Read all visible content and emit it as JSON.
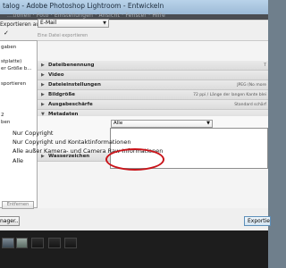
{
  "window": {
    "title": "talog - Adobe Photoshop Lightroom - Entwickeln"
  },
  "menubar": {
    "text": "...tionen  ·  Foto  ·  Einstellungen  ·  Ansicht  ·  Fenster  ·  Hilfe"
  },
  "export": {
    "label": "Exportieren auf:",
    "destination": "E-Mail",
    "preset_caption": "Eine Datei exportieren"
  },
  "presets_panel": {
    "items": [
      "gaben",
      "stplatte)",
      "er Größe b...",
      "sportieren",
      "2",
      "ben"
    ],
    "remove_button": "Entfernen"
  },
  "sections": [
    {
      "title": "Dateibenennung",
      "summary": "T"
    },
    {
      "title": "Video",
      "summary": ""
    },
    {
      "title": "Dateieinstellungen",
      "summary": "JPEG (No more"
    },
    {
      "title": "Bildgröße",
      "summary": "72 ppi / Länge der langen Kante blei"
    },
    {
      "title": "Ausgabeschärfe",
      "summary": "Standard schärf"
    },
    {
      "title": "Metadaten",
      "summary": ""
    },
    {
      "title": "Wasserzeichen",
      "summary": ""
    }
  ],
  "metadata": {
    "selected": "Alle",
    "options": [
      "Nur Copyright",
      "Nur Copyright und Kontaktinformationen",
      "Alle außer Kamera- und Camera Raw-Informationen",
      "Alle"
    ],
    "checked_option": "Alle"
  },
  "buttons": {
    "manager": "nager...",
    "export": "Exportiere"
  },
  "colors": {
    "highlight_ellipse": "#c9141a",
    "dialog_bg": "#efefef",
    "filmstrip_bg": "#1d1d1d"
  }
}
